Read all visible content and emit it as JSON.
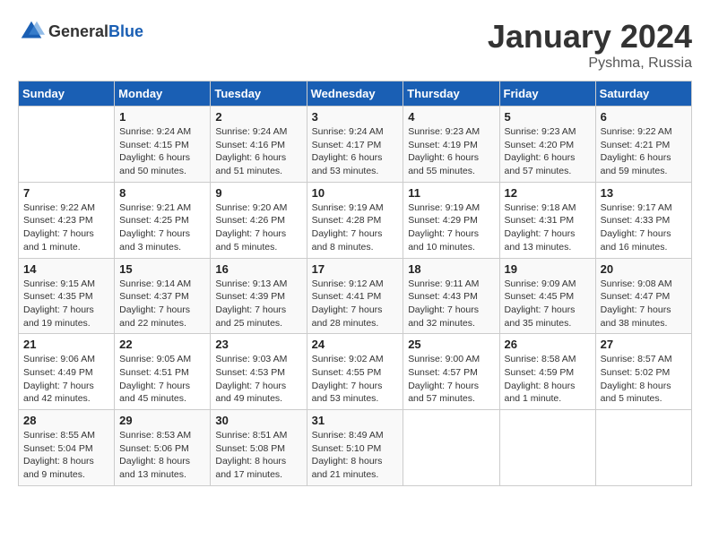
{
  "logo": {
    "text_general": "General",
    "text_blue": "Blue"
  },
  "title": {
    "month_year": "January 2024",
    "location": "Pyshma, Russia"
  },
  "weekdays": [
    "Sunday",
    "Monday",
    "Tuesday",
    "Wednesday",
    "Thursday",
    "Friday",
    "Saturday"
  ],
  "weeks": [
    [
      {
        "day": "",
        "info": ""
      },
      {
        "day": "1",
        "info": "Sunrise: 9:24 AM\nSunset: 4:15 PM\nDaylight: 6 hours\nand 50 minutes."
      },
      {
        "day": "2",
        "info": "Sunrise: 9:24 AM\nSunset: 4:16 PM\nDaylight: 6 hours\nand 51 minutes."
      },
      {
        "day": "3",
        "info": "Sunrise: 9:24 AM\nSunset: 4:17 PM\nDaylight: 6 hours\nand 53 minutes."
      },
      {
        "day": "4",
        "info": "Sunrise: 9:23 AM\nSunset: 4:19 PM\nDaylight: 6 hours\nand 55 minutes."
      },
      {
        "day": "5",
        "info": "Sunrise: 9:23 AM\nSunset: 4:20 PM\nDaylight: 6 hours\nand 57 minutes."
      },
      {
        "day": "6",
        "info": "Sunrise: 9:22 AM\nSunset: 4:21 PM\nDaylight: 6 hours\nand 59 minutes."
      }
    ],
    [
      {
        "day": "7",
        "info": "Sunrise: 9:22 AM\nSunset: 4:23 PM\nDaylight: 7 hours\nand 1 minute."
      },
      {
        "day": "8",
        "info": "Sunrise: 9:21 AM\nSunset: 4:25 PM\nDaylight: 7 hours\nand 3 minutes."
      },
      {
        "day": "9",
        "info": "Sunrise: 9:20 AM\nSunset: 4:26 PM\nDaylight: 7 hours\nand 5 minutes."
      },
      {
        "day": "10",
        "info": "Sunrise: 9:19 AM\nSunset: 4:28 PM\nDaylight: 7 hours\nand 8 minutes."
      },
      {
        "day": "11",
        "info": "Sunrise: 9:19 AM\nSunset: 4:29 PM\nDaylight: 7 hours\nand 10 minutes."
      },
      {
        "day": "12",
        "info": "Sunrise: 9:18 AM\nSunset: 4:31 PM\nDaylight: 7 hours\nand 13 minutes."
      },
      {
        "day": "13",
        "info": "Sunrise: 9:17 AM\nSunset: 4:33 PM\nDaylight: 7 hours\nand 16 minutes."
      }
    ],
    [
      {
        "day": "14",
        "info": "Sunrise: 9:15 AM\nSunset: 4:35 PM\nDaylight: 7 hours\nand 19 minutes."
      },
      {
        "day": "15",
        "info": "Sunrise: 9:14 AM\nSunset: 4:37 PM\nDaylight: 7 hours\nand 22 minutes."
      },
      {
        "day": "16",
        "info": "Sunrise: 9:13 AM\nSunset: 4:39 PM\nDaylight: 7 hours\nand 25 minutes."
      },
      {
        "day": "17",
        "info": "Sunrise: 9:12 AM\nSunset: 4:41 PM\nDaylight: 7 hours\nand 28 minutes."
      },
      {
        "day": "18",
        "info": "Sunrise: 9:11 AM\nSunset: 4:43 PM\nDaylight: 7 hours\nand 32 minutes."
      },
      {
        "day": "19",
        "info": "Sunrise: 9:09 AM\nSunset: 4:45 PM\nDaylight: 7 hours\nand 35 minutes."
      },
      {
        "day": "20",
        "info": "Sunrise: 9:08 AM\nSunset: 4:47 PM\nDaylight: 7 hours\nand 38 minutes."
      }
    ],
    [
      {
        "day": "21",
        "info": "Sunrise: 9:06 AM\nSunset: 4:49 PM\nDaylight: 7 hours\nand 42 minutes."
      },
      {
        "day": "22",
        "info": "Sunrise: 9:05 AM\nSunset: 4:51 PM\nDaylight: 7 hours\nand 45 minutes."
      },
      {
        "day": "23",
        "info": "Sunrise: 9:03 AM\nSunset: 4:53 PM\nDaylight: 7 hours\nand 49 minutes."
      },
      {
        "day": "24",
        "info": "Sunrise: 9:02 AM\nSunset: 4:55 PM\nDaylight: 7 hours\nand 53 minutes."
      },
      {
        "day": "25",
        "info": "Sunrise: 9:00 AM\nSunset: 4:57 PM\nDaylight: 7 hours\nand 57 minutes."
      },
      {
        "day": "26",
        "info": "Sunrise: 8:58 AM\nSunset: 4:59 PM\nDaylight: 8 hours\nand 1 minute."
      },
      {
        "day": "27",
        "info": "Sunrise: 8:57 AM\nSunset: 5:02 PM\nDaylight: 8 hours\nand 5 minutes."
      }
    ],
    [
      {
        "day": "28",
        "info": "Sunrise: 8:55 AM\nSunset: 5:04 PM\nDaylight: 8 hours\nand 9 minutes."
      },
      {
        "day": "29",
        "info": "Sunrise: 8:53 AM\nSunset: 5:06 PM\nDaylight: 8 hours\nand 13 minutes."
      },
      {
        "day": "30",
        "info": "Sunrise: 8:51 AM\nSunset: 5:08 PM\nDaylight: 8 hours\nand 17 minutes."
      },
      {
        "day": "31",
        "info": "Sunrise: 8:49 AM\nSunset: 5:10 PM\nDaylight: 8 hours\nand 21 minutes."
      },
      {
        "day": "",
        "info": ""
      },
      {
        "day": "",
        "info": ""
      },
      {
        "day": "",
        "info": ""
      }
    ]
  ]
}
